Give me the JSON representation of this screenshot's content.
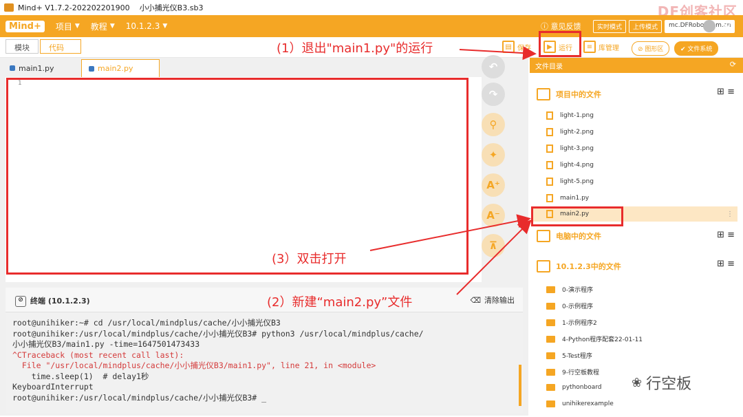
{
  "titlebar": {
    "app": "Mind+ V1.7.2-202202201900",
    "file": "小小捕光仪B3.sb3"
  },
  "watermark_top": "DF创客社区",
  "watermark_sub": "mc.DFRobot.com.cn",
  "topbar": {
    "brand": "Mind+",
    "menus": [
      "项目",
      "教程",
      "10.1.2.3"
    ],
    "feedback": "意见反馈",
    "modes": [
      "实时模式",
      "上传模式",
      "Python模式"
    ]
  },
  "toolbar": {
    "tabs": [
      "模块",
      "代码"
    ],
    "save": "保存",
    "run": "运行",
    "lib": "库管理",
    "graphics": "图形区",
    "filesystem": "文件系统"
  },
  "editor": {
    "tabs": [
      "main1.py",
      "main2.py"
    ],
    "line_numbers": [
      "1"
    ]
  },
  "terminal": {
    "title": "终端 (10.1.2.3)",
    "clear": "清除输出",
    "lines": [
      {
        "text": "root@unihiker:~# cd /usr/local/mindplus/cache/小小捕光仪B3",
        "style": "ok"
      },
      {
        "text": "root@unihiker:/usr/local/mindplus/cache/小小捕光仪B3# python3 /usr/local/mindplus/cache/",
        "style": "ok"
      },
      {
        "text": "小小捕光仪B3/main1.py -time=1647501473433",
        "style": "ok"
      },
      {
        "text": "^CTraceback (most recent call last):",
        "style": "err"
      },
      {
        "text": "  File \"/usr/local/mindplus/cache/小小捕光仪B3/main1.py\", line 21, in <module>",
        "style": "err"
      },
      {
        "text": "    time.sleep(1)  # delay1秒",
        "style": "ok"
      },
      {
        "text": "KeyboardInterrupt",
        "style": "ok"
      },
      {
        "text": "root@unihiker:/usr/local/mindplus/cache/小小捕光仪B3# _",
        "style": "ok"
      }
    ]
  },
  "filepanel": {
    "header": "文件目录",
    "project_section": "项目中的文件",
    "project_files": [
      "light-1.png",
      "light-2.png",
      "light-3.png",
      "light-4.png",
      "light-5.png",
      "main1.py",
      "main2.py"
    ],
    "computer_section": "电脑中的文件",
    "device_section": "10.1.2.3中的文件",
    "device_folders": [
      "0-演示程序",
      "0-示例程序",
      "1-示例程序2",
      "4-Python程序配套22-01-11",
      "5-Test程序",
      "9-行空板教程",
      "pythonboard",
      "unihikerexample"
    ]
  },
  "annotations": {
    "step1": "(1）退出\"main1.py\"的运行",
    "step2": "(2）新建“main2.py”文件",
    "step3": "(3）双击打开"
  },
  "wechat": "行空板",
  "colors": {
    "accent": "#f5a623",
    "annotation": "#e82c2c"
  }
}
